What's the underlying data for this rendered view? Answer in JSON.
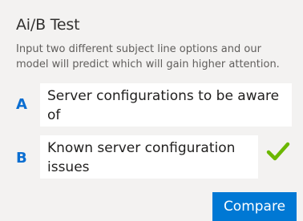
{
  "header": {
    "title": "Ai/B Test",
    "description": "Input two different subject line options and our model will predict which will gain higher attention."
  },
  "options": [
    {
      "letter": "A",
      "subject": "Server configurations to be aware of",
      "winner": false
    },
    {
      "letter": "B",
      "subject": "Known server configuration issues",
      "winner": true
    }
  ],
  "actions": {
    "compare_label": "Compare"
  },
  "icons": {
    "winner_indicator": "check-icon"
  },
  "colors": {
    "background": "#f3f2f1",
    "letter_accent": "#0a6ed1",
    "button_bg": "#0078d4",
    "check_green": "#6bb700"
  }
}
